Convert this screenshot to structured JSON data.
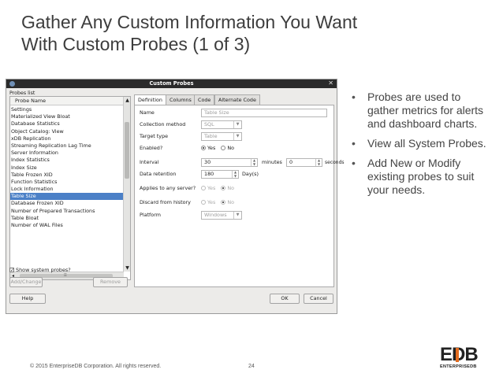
{
  "slide": {
    "title_line1": "Gather Any Custom Information You Want",
    "title_line2": "With Custom Probes (1 of 3)",
    "footer": "© 2015 EnterpriseDB Corporation. All rights reserved.",
    "page_number": "24",
    "bullets": [
      "Probes are used to gather metrics for alerts and dashboard charts.",
      "View all System Probes.",
      "Add New or Modify existing probes to suit your needs."
    ],
    "logo": {
      "mark": "EDB",
      "subtitle": "ENTERPRISEDB"
    }
  },
  "dialog": {
    "title": "Custom Probes",
    "probes_list_label": "Probes list",
    "probe_name_header": "Probe Name",
    "probes": [
      "Settings",
      "Materialized View Bloat",
      "Database Statistics",
      "Object Catalog: View",
      "xDB Replication",
      "Streaming Replication Lag Time",
      "Server Information",
      "Index Statistics",
      "Index Size",
      "Table Frozen XID",
      "Function Statistics",
      "Lock Information",
      "Table Size",
      "Database Frozen XID",
      "Number of Prepared Transactions",
      "Table Bloat",
      "Number of WAL Files"
    ],
    "selected_probe": "Table Size",
    "show_system_probes_label": "Show system probes?",
    "show_system_probes_checked": true,
    "add_change_label": "Add/Change",
    "remove_label": "Remove",
    "help_label": "Help",
    "ok_label": "OK",
    "cancel_label": "Cancel",
    "tabs": [
      "Definition",
      "Columns",
      "Code",
      "Alternate Code"
    ],
    "active_tab": "Definition",
    "form": {
      "name_label": "Name",
      "name_value": "Table Size",
      "collection_method_label": "Collection method",
      "collection_method_value": "SQL",
      "target_type_label": "Target type",
      "target_type_value": "Table",
      "enabled_label": "Enabled?",
      "yes_label": "Yes",
      "no_label": "No",
      "interval_label": "Interval",
      "interval_minutes": "30",
      "minutes_label": "minutes",
      "interval_seconds": "0",
      "seconds_label": "seconds",
      "data_retention_label": "Data retention",
      "data_retention_value": "180",
      "days_label": "Day(s)",
      "applies_label": "Applies to any server?",
      "discard_label": "Discard from history",
      "platform_label": "Platform",
      "platform_value": "Windows"
    }
  }
}
